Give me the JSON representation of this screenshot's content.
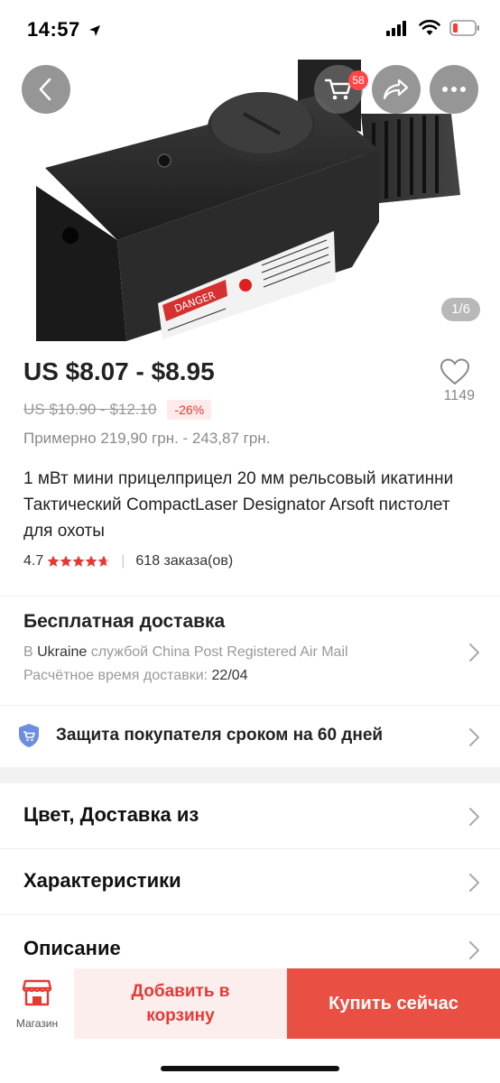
{
  "status_bar": {
    "time": "14:57"
  },
  "hero": {
    "cart_count": "58",
    "page_indicator": "1/6"
  },
  "product": {
    "price": "US $8.07 - $8.95",
    "old_price": "US $10.90 - $12.10",
    "discount": "-26%",
    "approx_price": "Примерно 219,90 грн. - 243,87 грн.",
    "wishlist_count": "1149",
    "title": "1 мВт мини прицелприцел 20 мм рельсовый икатинни Тактический CompactLaser Designator Arsoft пистолет для охоты",
    "rating": "4.7",
    "rating_stars": 4.7,
    "orders": "618 заказа(ов)"
  },
  "shipping": {
    "title": "Бесплатная доставка",
    "to_prefix": "В",
    "country": "Ukraine",
    "service": "службой China Post Registered Air Mail",
    "eta_label": "Расчётное время доставки:",
    "eta_value": "22/04"
  },
  "protection": {
    "text": "Защита покупателя сроком на 60 дней"
  },
  "menu": {
    "color_delivery": "Цвет, Доставка из",
    "specs": "Характеристики",
    "description": "Описание"
  },
  "bottom_bar": {
    "store_label": "Магазин",
    "add_to_cart": "Добавить в корзину",
    "buy_now": "Купить сейчас"
  },
  "colors": {
    "accent": "#ea4f43",
    "discount_text": "#e53935",
    "badge": "#ff4747",
    "protection_icon": "#6b8ee0"
  },
  "icons": [
    "back-icon",
    "cart-icon",
    "share-icon",
    "more-icon",
    "heart-icon",
    "star-icon",
    "chevron-right-icon",
    "shield-cart-icon",
    "store-icon"
  ]
}
